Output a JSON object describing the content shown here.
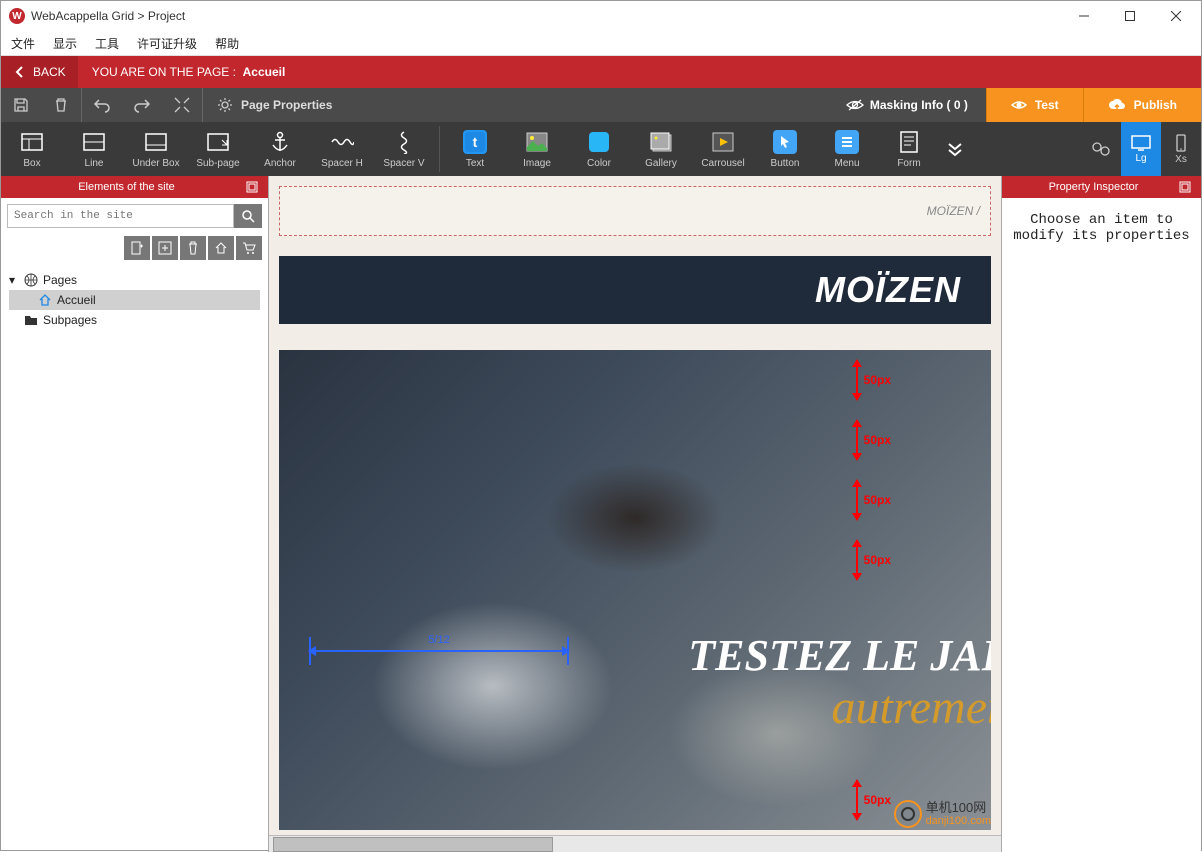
{
  "window": {
    "title": "WebAcappella Grid > Project"
  },
  "menu": {
    "file": "文件",
    "show": "显示",
    "tools": "工具",
    "license": "许可证升级",
    "help": "帮助"
  },
  "redbar": {
    "back": "BACK",
    "prefix": "YOU ARE ON THE PAGE :",
    "page": "Accueil"
  },
  "toolbar1": {
    "page_properties": "Page Properties",
    "masking": "Masking Info ( 0 )",
    "test": "Test",
    "publish": "Publish"
  },
  "tools": {
    "box": "Box",
    "line": "Line",
    "underbox": "Under Box",
    "subpage": "Sub-page",
    "anchor": "Anchor",
    "spacerh": "Spacer H",
    "spacerv": "Spacer V",
    "text": "Text",
    "image": "Image",
    "color": "Color",
    "gallery": "Gallery",
    "carrousel": "Carrousel",
    "button": "Button",
    "menu": "Menu",
    "form": "Form"
  },
  "device": {
    "lg": "Lg",
    "xs": "Xs"
  },
  "left": {
    "title": "Elements of the site",
    "search_placeholder": "Search in the site",
    "pages": "Pages",
    "accueil": "Accueil",
    "subpages": "Subpages"
  },
  "canvas": {
    "breadcrumb": "MOÏZEN /",
    "brand": "MOÏZEN",
    "hero_line1": "TESTEZ LE JAF",
    "hero_line2": "autremen",
    "m50": "50px",
    "m_h": "5/12"
  },
  "right": {
    "title": "Property Inspector",
    "body": "Choose an item to modify its properties"
  },
  "watermark": {
    "cn": "单机100网",
    "url": "danji100.com"
  }
}
